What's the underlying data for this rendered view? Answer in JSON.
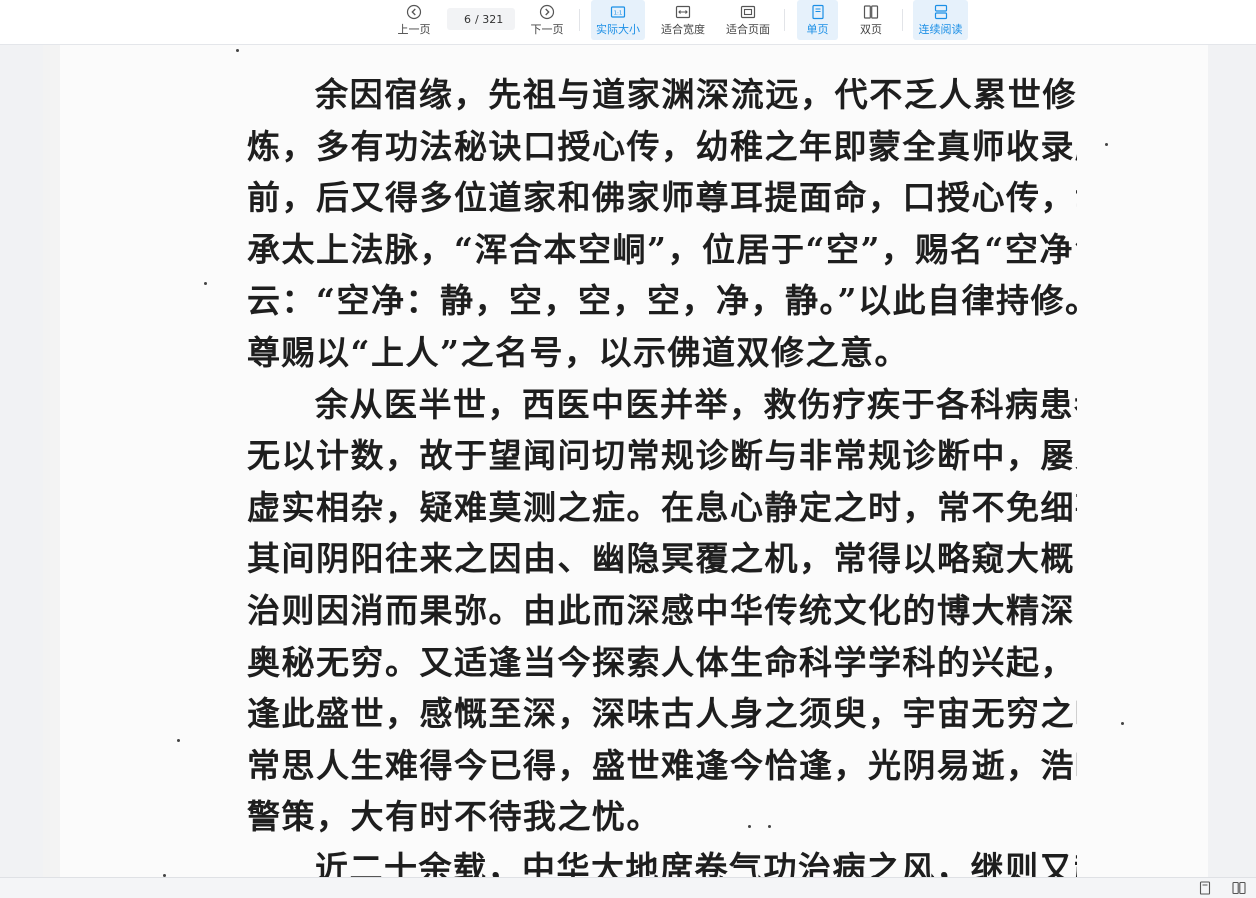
{
  "toolbar": {
    "prev_label": "上一页",
    "next_label": "下一页",
    "page_current": "6",
    "page_total": "/ 321",
    "actual_size_label": "实际大小",
    "fit_width_label": "适合宽度",
    "fit_page_label": "适合页面",
    "single_page_label": "单页",
    "double_page_label": "双页",
    "continuous_label": "连续阅读",
    "accent_color": "#1b8fe6",
    "active_bg": "#e6f1fb",
    "icons": [
      "prev-page-icon",
      "next-page-icon",
      "actual-size-icon",
      "fit-width-icon",
      "fit-page-icon",
      "single-page-icon",
      "double-page-icon",
      "continuous-icon"
    ]
  },
  "document": {
    "lines": [
      "余因宿缘，先祖与道家渊深流远，代不乏人累世修",
      "炼，多有功法秘诀口授心传，幼稚之年即蒙全真师收录膝",
      "前，后又得多位道家和佛家师尊耳提面命，口授心传，幸",
      "承太上法脉，“浑合本空峒”，位居于“空”，赐名“空净”，师",
      "云：“空净：静，空，空，空，净，静。”以此自律持修。佛家师",
      "尊赐以“上人”之名号，以示佛道双修之意。",
      "余从医半世，西医中医并举，救伤疗疾于各科病患者",
      "无以计数，故于望闻问切常规诊断与非常规诊断中，屡见",
      "虚实相杂，疑难莫测之症。在息心静定之时，常不免细勘",
      "其间阴阳往来之因由、幽隐冥覆之机，常得以略窥大概，",
      "治则因消而果弥。由此而深感中华传统文化的博大精深，",
      "奥秘无穷。又适逢当今探索人体生命科学学科的兴起，时",
      "逢此盛世，感慨至深，深味古人身之须臾，宇宙无穷之叹。",
      "常思人生难得今已得，盛世难逢今恰逢，光阴易逝，浩叹",
      "警策，大有时不待我之忧。",
      "近二十余载，中华大地席卷气功治病之风，继则又起"
    ]
  },
  "statusbar": {
    "icons": [
      "single-page-view-icon",
      "double-page-view-icon"
    ]
  }
}
